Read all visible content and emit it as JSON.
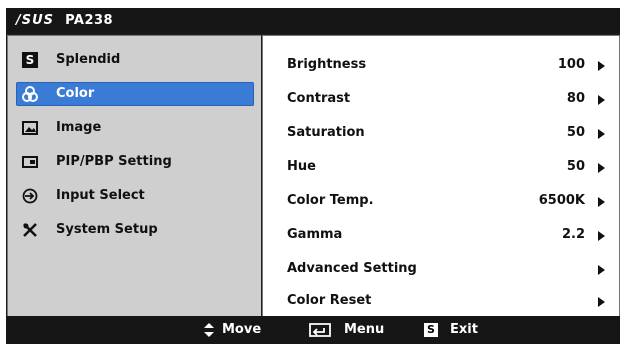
{
  "topbar": {
    "brand_logo": "/SUS",
    "model": "PA238"
  },
  "sidebar": {
    "items": [
      {
        "label": "Splendid",
        "icon": "splendid-s-icon"
      },
      {
        "label": "Color",
        "icon": "color-rgb-icon",
        "active": true
      },
      {
        "label": "Image",
        "icon": "image-icon"
      },
      {
        "label": "PIP/PBP Setting",
        "icon": "pip-icon"
      },
      {
        "label": "Input Select",
        "icon": "input-icon"
      },
      {
        "label": "System Setup",
        "icon": "tools-icon"
      }
    ]
  },
  "main": {
    "rows": [
      {
        "label": "Brightness",
        "value": "100"
      },
      {
        "label": "Contrast",
        "value": "80"
      },
      {
        "label": "Saturation",
        "value": "50"
      },
      {
        "label": "Hue",
        "value": "50"
      },
      {
        "label": "Color Temp.",
        "value": "6500K"
      },
      {
        "label": "Gamma",
        "value": "2.2"
      },
      {
        "label": "Advanced Setting",
        "value": ""
      },
      {
        "label": "Color Reset",
        "value": ""
      }
    ]
  },
  "bottombar": {
    "move_label": "Move",
    "menu_label": "Menu",
    "exit_label": "Exit",
    "exit_key": "S"
  },
  "colors": {
    "accent": "#3a7bd5",
    "sidebar_bg": "#cfcfcf",
    "bar_bg": "#161616"
  }
}
